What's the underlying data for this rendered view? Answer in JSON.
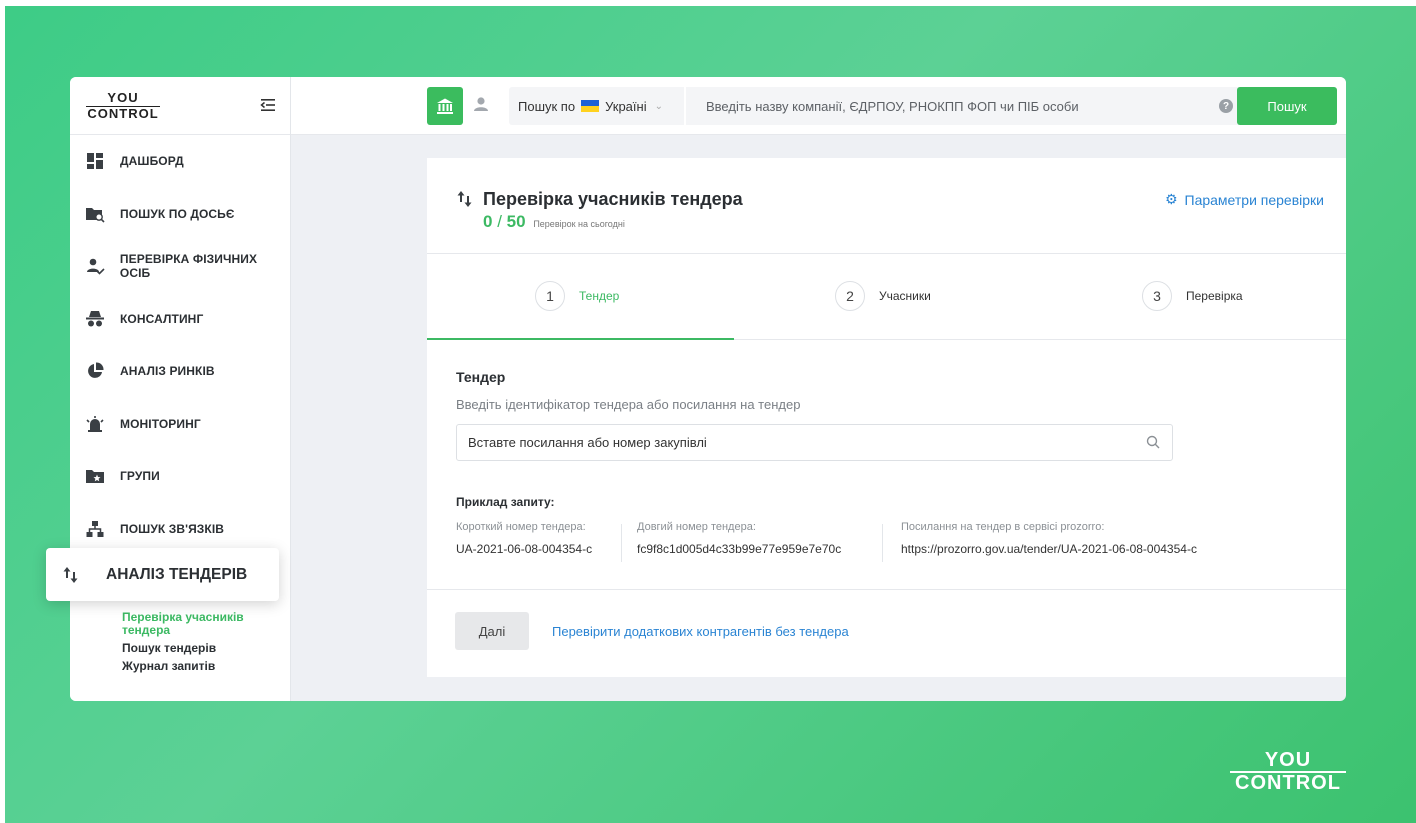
{
  "brand": {
    "logo_line1": "YOU",
    "logo_line2": "CONTROL",
    "accent": "#3bbc5e",
    "link": "#2a84d3"
  },
  "sidebar": {
    "items": [
      {
        "label": "ДАШБОРД",
        "icon": "dashboard-icon"
      },
      {
        "label": "ПОШУК ПО ДОСЬЄ",
        "icon": "folder-search-icon"
      },
      {
        "label": "ПЕРЕВІРКА ФІЗИЧНИХ ОСІБ",
        "icon": "person-check-icon"
      },
      {
        "label": "КОНСАЛТИНГ",
        "icon": "spy-icon"
      },
      {
        "label": "АНАЛІЗ РИНКІВ",
        "icon": "pie-chart-icon"
      },
      {
        "label": "МОНІТОРИНГ",
        "icon": "alarm-icon"
      },
      {
        "label": "ГРУПИ",
        "icon": "folder-star-icon"
      },
      {
        "label": "ПОШУК ЗВ'ЯЗКІВ",
        "icon": "hierarchy-icon"
      }
    ],
    "active_item": {
      "label": "АНАЛІЗ ТЕНДЕРІВ",
      "icon": "sort-arrows-icon"
    },
    "submenu": [
      {
        "label": "Перевірка учасників тендера",
        "active": true
      },
      {
        "label": "Пошук тендерів",
        "active": false
      },
      {
        "label": "Журнал запитів",
        "active": false
      }
    ]
  },
  "topbar": {
    "search_by_label": "Пошук по",
    "country": "Україні",
    "search_placeholder": "Введіть назву компанії, ЄДРПОУ, РНОКПП ФОП чи ПІБ особи",
    "help": "?",
    "search_button": "Пошук"
  },
  "page": {
    "title": "Перевірка учасників тендера",
    "counter_used": "0",
    "counter_sep": "/",
    "counter_max": "50",
    "counter_note": "Перевірок на сьогодні",
    "params_link": "Параметри перевірки"
  },
  "steps": [
    {
      "num": "1",
      "label": "Тендер",
      "active": true
    },
    {
      "num": "2",
      "label": "Учасники",
      "active": false
    },
    {
      "num": "3",
      "label": "Перевірка",
      "active": false
    }
  ],
  "form": {
    "title": "Тендер",
    "hint": "Введіть ідентифікатор тендера або посилання на тендер",
    "input_placeholder": "Вставте посилання або номер закупівлі",
    "example_title": "Приклад запиту:",
    "examples": [
      {
        "label": "Короткий номер тендера:",
        "value": "UA-2021-06-08-004354-c"
      },
      {
        "label": "Довгий номер тендера:",
        "value": "fc9f8c1d005d4c33b99e77e959e7e70c"
      },
      {
        "label": "Посилання на тендер в сервісі prozorro:",
        "value": "https://prozorro.gov.ua/tender/UA-2021-06-08-004354-c"
      }
    ]
  },
  "footer": {
    "next_button": "Далі",
    "extra_link": "Перевірити додаткових контрагентів без тендера"
  },
  "watermark": {
    "line1": "YOU",
    "line2": "CONTROL"
  }
}
